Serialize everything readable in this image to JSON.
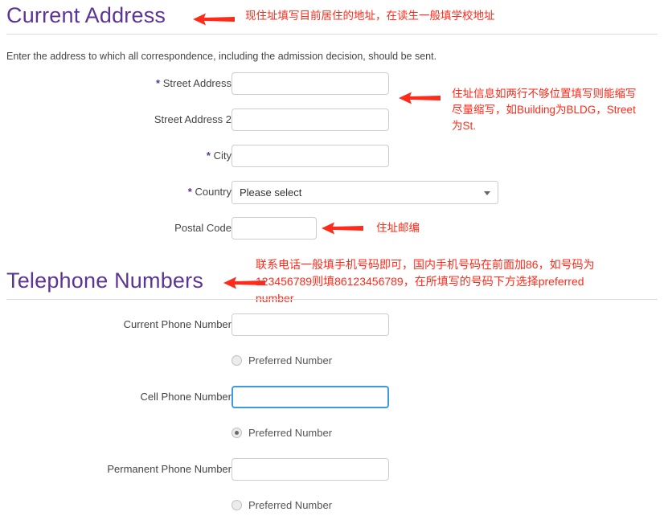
{
  "colors": {
    "heading_purple": "#5c3494",
    "annotation_red": "#ff2a1a",
    "focus_blue": "#3c9ae0",
    "rule_gray": "#dcdcdc"
  },
  "sections": {
    "address": {
      "heading": "Current Address",
      "intro": "Enter the address to which all correspondence, including the admission decision, should be sent.",
      "fields": [
        {
          "label": "Street Address",
          "required": true,
          "value": "",
          "placeholder": "",
          "type": "text"
        },
        {
          "label": "Street Address 2",
          "required": false,
          "value": "",
          "placeholder": "",
          "type": "text"
        },
        {
          "label": "City",
          "required": true,
          "value": "",
          "placeholder": "",
          "type": "text"
        },
        {
          "label": "Country",
          "required": true,
          "value": "Please select",
          "type": "select"
        },
        {
          "label": "Postal Code",
          "required": false,
          "value": "",
          "placeholder": "",
          "type": "text"
        }
      ]
    },
    "telephone": {
      "heading": "Telephone Numbers",
      "fields": [
        {
          "label": "Current Phone Number",
          "required": false,
          "value": "",
          "placeholder": "",
          "focused": false
        },
        {
          "label": "Cell Phone Number",
          "required": false,
          "value": "",
          "placeholder": "",
          "focused": true
        },
        {
          "label": "Permanent Phone Number",
          "required": false,
          "value": "",
          "placeholder": "",
          "focused": false
        }
      ],
      "radios": [
        {
          "label": "Preferred Number",
          "checked": false
        },
        {
          "label": "Preferred Number",
          "checked": true
        },
        {
          "label": "Preferred Number",
          "checked": false
        }
      ]
    }
  },
  "annotations": {
    "address_heading": "现住址填写目前居住的地址，在读生一般填学校地址",
    "street_address": "住址信息如两行不够位置填写则能缩写\n尽量缩写，如Building为BLDG，Street\n为St.",
    "postal_code": "住址邮编",
    "telephone_heading": "联系电话一般填手机号码即可，国内手机号码在前面加86，如号码为\n123456789则填86123456789，在所填写的号码下方选择preferred\nnumber"
  },
  "icons": {
    "arrow": "left-arrow-icon",
    "caret": "chevron-down-icon"
  }
}
